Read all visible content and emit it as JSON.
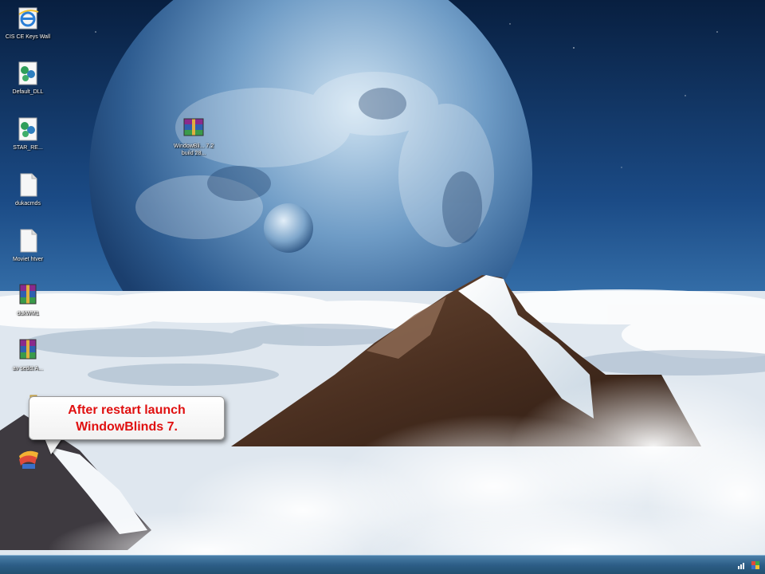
{
  "desktop": {
    "icons": [
      {
        "label": "CIS CE Keys Wall",
        "icon": "internet-explorer-icon"
      },
      {
        "label": "Default_DLL",
        "icon": "dll-icon"
      },
      {
        "label": "STAR_RE...",
        "icon": "dll-icon"
      },
      {
        "label": "dukacmds",
        "icon": "file-icon"
      },
      {
        "label": "Moviet htver",
        "icon": "file-icon"
      },
      {
        "label": "dukWM1",
        "icon": "winrar-icon"
      },
      {
        "label": "av sedct A...",
        "icon": "winrar-icon"
      },
      {
        "label": "",
        "icon": "folder-icon"
      },
      {
        "label": "",
        "icon": "windowblinds-icon"
      },
      {
        "label": "WindowBli... 7.2 build 28...",
        "icon": "winrar-icon"
      }
    ]
  },
  "callout": {
    "line1": "After restart launch",
    "line2": "WindowBlinds 7.",
    "text_color": "#e01010"
  },
  "taskbar": {
    "tray_icons": [
      "network-icon",
      "flag-icon"
    ]
  },
  "colors": {
    "sky_top": "#0b2a52",
    "sky_mid": "#2a5f9a",
    "cloud": "#e9eef3",
    "taskbar": "#2c5d86"
  }
}
